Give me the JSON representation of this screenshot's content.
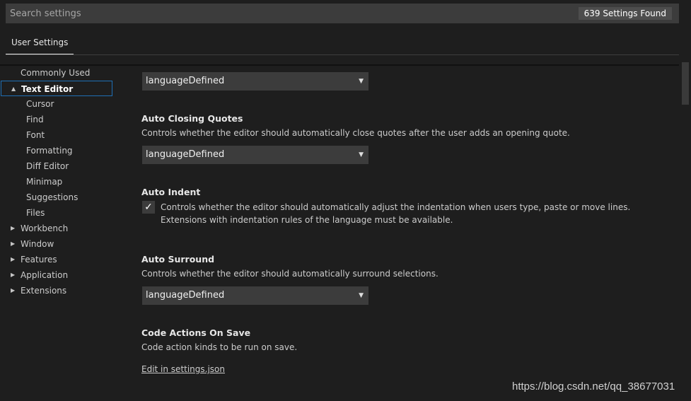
{
  "search": {
    "placeholder": "Search settings",
    "count_label": "639 Settings Found"
  },
  "tabs": [
    {
      "label": "User Settings",
      "active": true
    }
  ],
  "toc": {
    "items": [
      {
        "label": "Commonly Used",
        "twist": ""
      },
      {
        "label": "Text Editor",
        "twist": "▲",
        "selected": true
      },
      {
        "label": "Cursor",
        "child": true
      },
      {
        "label": "Find",
        "child": true
      },
      {
        "label": "Font",
        "child": true
      },
      {
        "label": "Formatting",
        "child": true
      },
      {
        "label": "Diff Editor",
        "child": true
      },
      {
        "label": "Minimap",
        "child": true
      },
      {
        "label": "Suggestions",
        "child": true
      },
      {
        "label": "Files",
        "child": true
      },
      {
        "label": "Workbench",
        "twist": "▶"
      },
      {
        "label": "Window",
        "twist": "▶"
      },
      {
        "label": "Features",
        "twist": "▶"
      },
      {
        "label": "Application",
        "twist": "▶"
      },
      {
        "label": "Extensions",
        "twist": "▶"
      }
    ]
  },
  "settings": {
    "top_select_value": "languageDefined",
    "auto_closing_quotes": {
      "title": "Auto Closing Quotes",
      "description": "Controls whether the editor should automatically close quotes after the user adds an opening quote.",
      "value": "languageDefined"
    },
    "auto_indent": {
      "title": "Auto Indent",
      "description": "Controls whether the editor should automatically adjust the indentation when users type, paste or move lines. Extensions with indentation rules of the language must be available.",
      "checked": true,
      "check_glyph": "✓"
    },
    "auto_surround": {
      "title": "Auto Surround",
      "description": "Controls whether the editor should automatically surround selections.",
      "value": "languageDefined"
    },
    "code_actions_on_save": {
      "title": "Code Actions On Save",
      "description": "Code action kinds to be run on save.",
      "link": "Edit in settings.json"
    },
    "dropdown_arrow": "▼"
  },
  "watermark": "https://blog.csdn.net/qq_38677031",
  "colors": {
    "background": "#1e1e1e",
    "input_background": "#3c3c3c",
    "selection_border": "#1f6fb5",
    "badge_background": "#4d4d4d"
  }
}
